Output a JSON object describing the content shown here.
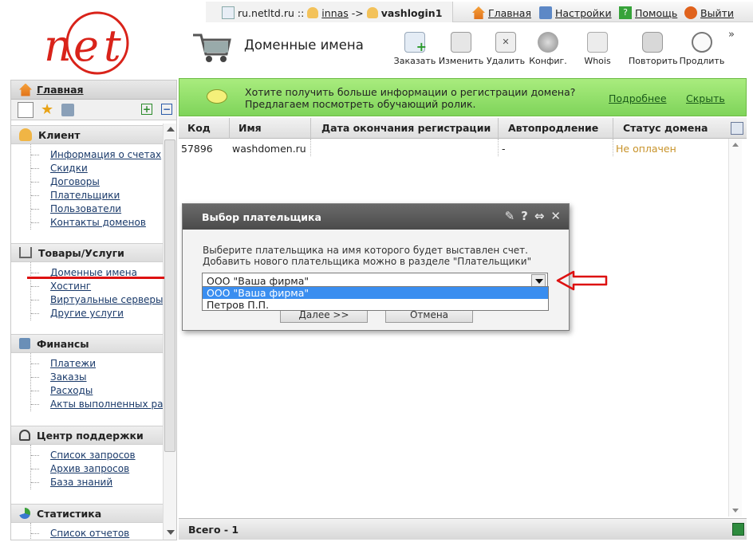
{
  "header": {
    "site": "ru.netltd.ru ::",
    "user": "innas",
    "arrow": "->",
    "login": "vashlogin1",
    "links": {
      "home": "Главная",
      "settings": "Настройки",
      "help": "Помощь",
      "logout": "Выйти"
    },
    "page_title": "Доменные имена",
    "overflow": "»"
  },
  "toolbar": {
    "order": "Заказать",
    "edit": "Изменить",
    "delete": "Удалить",
    "config": "Конфиг.",
    "whois": "Whois",
    "repeat": "Повторить",
    "extend": "Продлить"
  },
  "sidebar": {
    "home": "Главная",
    "groups": [
      {
        "title": "Клиент",
        "links": [
          "Информация о счетах",
          "Скидки",
          "Договоры",
          "Плательщики",
          "Пользователи",
          "Контакты доменов"
        ]
      },
      {
        "title": "Товары/Услуги",
        "links": [
          "Доменные имена",
          "Хостинг",
          "Виртуальные серверы",
          "Другие услуги"
        ]
      },
      {
        "title": "Финансы",
        "links": [
          "Платежи",
          "Заказы",
          "Расходы",
          "Акты выполненных работ"
        ]
      },
      {
        "title": "Центр поддержки",
        "links": [
          "Список запросов",
          "Архив запросов",
          "База знаний"
        ]
      },
      {
        "title": "Статистика",
        "links": [
          "Список отчетов"
        ]
      }
    ]
  },
  "banner": {
    "line1": "Хотите получить больше информации о регистрации домена?",
    "line2": "Предлагаем посмотреть обучающий ролик.",
    "more": "Подробнее",
    "hide": "Скрыть"
  },
  "grid": {
    "columns": [
      "Код",
      "Имя",
      "Дата окончания регистрации",
      "Автопродление",
      "Статус домена"
    ],
    "rows": [
      {
        "code": "57896",
        "name": "washdomen.ru",
        "expires": "",
        "autorenew": "-",
        "status": "Не оплачен"
      }
    ],
    "footer": "Всего - 1"
  },
  "dialog": {
    "title": "Выбор плательщика",
    "message": "Выберите плательщика на имя которого будет выставлен счет. Добавить нового плательщика можно в разделе \"Плательщики\"",
    "selected": "ООО \"Ваша фирма\"",
    "options": [
      "ООО \"Ваша фирма\"",
      "Петров П.П."
    ],
    "next": "Далее >>",
    "cancel": "Отмена"
  },
  "colors": {
    "banner": "#8fdd66",
    "status_unpaid": "#c8932a",
    "dialog_title": "#555555",
    "annotation": "#dd1111",
    "selection": "#3a8ef0"
  }
}
